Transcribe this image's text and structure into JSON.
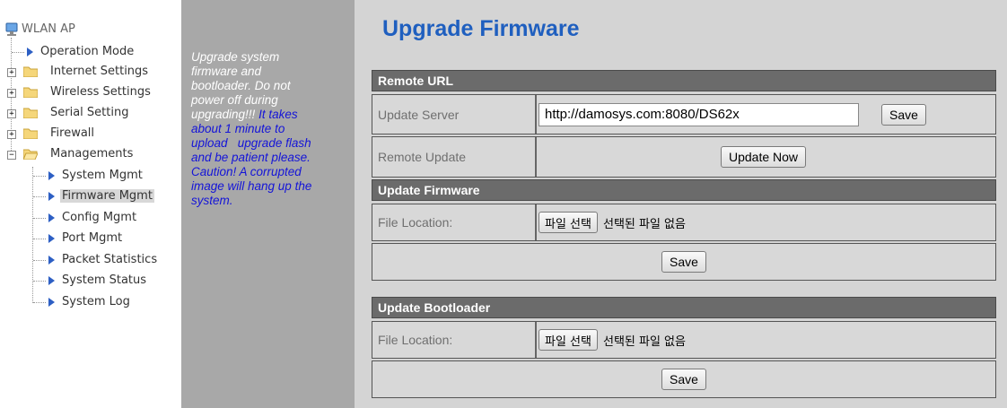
{
  "sidebar": {
    "root_label": "WLAN AP",
    "items": [
      {
        "label": "Operation Mode",
        "type": "page"
      },
      {
        "label": "Internet Settings",
        "type": "folder"
      },
      {
        "label": "Wireless Settings",
        "type": "folder"
      },
      {
        "label": "Serial Setting",
        "type": "folder"
      },
      {
        "label": "Firewall",
        "type": "folder"
      },
      {
        "label": "Managements",
        "type": "folder-open"
      },
      {
        "label": "System Mgmt",
        "type": "page"
      },
      {
        "label": "Firmware Mgmt",
        "type": "page",
        "selected": true
      },
      {
        "label": "Config Mgmt",
        "type": "page"
      },
      {
        "label": "Port Mgmt",
        "type": "page"
      },
      {
        "label": "Packet Statistics",
        "type": "page"
      },
      {
        "label": "System Status",
        "type": "page"
      },
      {
        "label": "System Log",
        "type": "page"
      }
    ]
  },
  "help": {
    "line1": "Upgrade system",
    "line2": "firmware and",
    "line3": "bootloader. Do not",
    "line4": "power off during",
    "line5_white": "upgrading!!! ",
    "line5_blue": "It takes",
    "line6": "about 1 minute to",
    "line7": "upload   upgrade flash",
    "line8": "and be patient please.",
    "line9": "Caution! A corrupted",
    "line10": "image will hang up the",
    "line11": "system."
  },
  "page": {
    "title": "Upgrade Firmware"
  },
  "remote_url": {
    "header": "Remote URL",
    "update_server_label": "Update Server",
    "update_server_value": "http://damosys.com:8080/DS62x",
    "save_label": "Save",
    "remote_update_label": "Remote Update",
    "update_now_label": "Update Now"
  },
  "update_firmware": {
    "header": "Update Firmware",
    "file_location_label": "File Location:",
    "choose_file_label": "파일 선택",
    "no_file_text": "선택된 파일 없음",
    "save_label": "Save"
  },
  "update_bootloader": {
    "header": "Update Bootloader",
    "file_location_label": "File Location:",
    "choose_file_label": "파일 선택",
    "no_file_text": "선택된 파일 없음",
    "save_label": "Save"
  },
  "colors": {
    "title_blue": "#1f5fbf",
    "help_bg": "#a8a8a8",
    "help_highlight": "#1414d8",
    "main_bg": "#d4d4d4",
    "section_header_bg": "#6b6b6b"
  }
}
